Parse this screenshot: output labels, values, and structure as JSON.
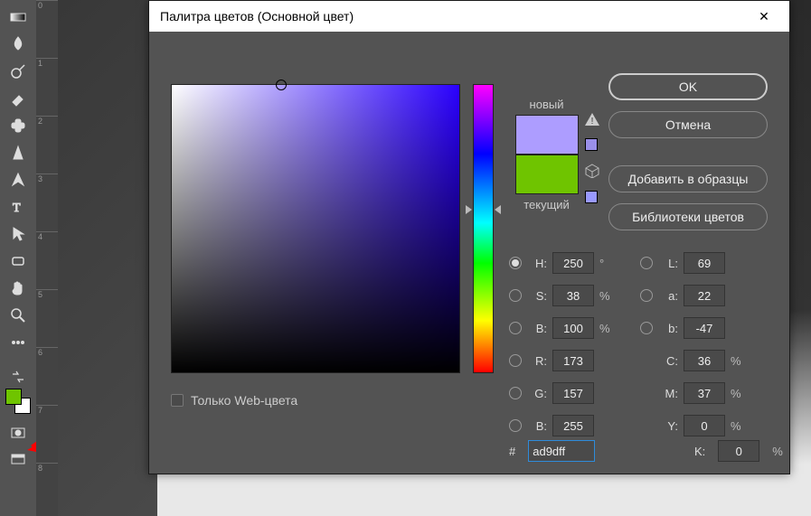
{
  "dialog": {
    "title": "Палитра цветов (Основной цвет)",
    "new_label": "новый",
    "current_label": "текущий",
    "new_color": "#ad9dff",
    "current_color": "#6fc400",
    "buttons": {
      "ok": "OK",
      "cancel": "Отмена",
      "add_swatch": "Добавить в образцы",
      "libraries": "Библиотеки цветов"
    },
    "web_only_label": "Только Web-цвета",
    "fields": {
      "H": {
        "label": "H:",
        "value": "250",
        "unit": "°"
      },
      "S": {
        "label": "S:",
        "value": "38",
        "unit": "%"
      },
      "Bv": {
        "label": "B:",
        "value": "100",
        "unit": "%"
      },
      "L": {
        "label": "L:",
        "value": "69"
      },
      "a": {
        "label": "a:",
        "value": "22"
      },
      "b": {
        "label": "b:",
        "value": "-47"
      },
      "R": {
        "label": "R:",
        "value": "173"
      },
      "G": {
        "label": "G:",
        "value": "157"
      },
      "Bc": {
        "label": "B:",
        "value": "255"
      },
      "C": {
        "label": "C:",
        "value": "36",
        "unit": "%"
      },
      "M": {
        "label": "M:",
        "value": "37",
        "unit": "%"
      },
      "Y": {
        "label": "Y:",
        "value": "0",
        "unit": "%"
      },
      "K": {
        "label": "K:",
        "value": "0",
        "unit": "%"
      },
      "hex_prefix": "#",
      "hex": "ad9dff"
    }
  },
  "ruler_ticks": [
    "0",
    "1",
    "2",
    "3",
    "4",
    "5",
    "6",
    "7",
    "8"
  ],
  "colors": {
    "foreground": "#6fc400",
    "background": "#ffffff"
  }
}
